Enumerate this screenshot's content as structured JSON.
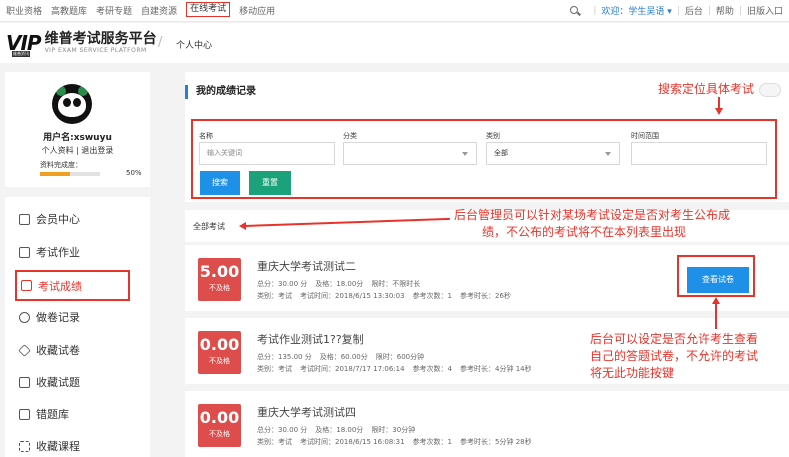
{
  "topnav": {
    "links": [
      "职业资格",
      "高教题库",
      "考研专题",
      "自建资源",
      "在线考试",
      "移动应用"
    ],
    "active_index": 4,
    "welcome": "欢迎：学生吴语 ▾",
    "right_links": [
      "后台",
      "帮助",
      "旧版入口"
    ]
  },
  "header": {
    "logo_mark": "VIP",
    "brand_sub": "维普资讯",
    "title_cn": "维普考试服务平台",
    "title_en": "VIP EXAM SERVICE PLATFORM",
    "breadcrumb": "个人中心"
  },
  "profile": {
    "username": "用户名:xswuyu",
    "links": "个人资料 | 退出登录",
    "completion_label": "资料完成度：",
    "completion_pct": "50%",
    "completion_value": 0.5
  },
  "menu": {
    "items": [
      "会员中心",
      "考试作业",
      "考试成绩",
      "做卷记录",
      "收藏试卷",
      "收藏试题",
      "错题库",
      "收藏课程"
    ],
    "active_index": 2
  },
  "records": {
    "title": "我的成绩记录",
    "filters": {
      "name_label": "名称",
      "name_placeholder": "输入关键词",
      "category_label": "分类",
      "type_label": "类别",
      "type_value": "全部",
      "time_label": "时间范围"
    },
    "search_btn": "搜索",
    "reset_btn": "重置",
    "list_title": "全部考试"
  },
  "exams": [
    {
      "score": "5.00",
      "status": "不及格",
      "name": "重庆大学考试测试二",
      "total": "总分：30.00 分",
      "pass": "及格：18.00分",
      "limit": "限时：不限时长",
      "type": "类别：考试",
      "time": "考试时间：2018/6/15 13:30:03",
      "attempts": "参考次数：1",
      "duration": "参考时长：26秒"
    },
    {
      "score": "0.00",
      "status": "不及格",
      "name": "考试作业测试1??复制",
      "total": "总分：135.00 分",
      "pass": "及格：60.00分",
      "limit": "限时：600分钟",
      "type": "类别：考试",
      "time": "考试时间：2018/7/17 17:06:14",
      "attempts": "参考次数：4",
      "duration": "参考时长：4分钟 14秒"
    },
    {
      "score": "0.00",
      "status": "不及格",
      "name": "重庆大学考试测试四",
      "total": "总分：30.00 分",
      "pass": "及格：18.00分",
      "limit": "限时：30分钟",
      "type": "类别：考试",
      "time": "考试时间：2018/6/15 16:08:31",
      "attempts": "参考次数：1",
      "duration": "参考时长：5分钟 28秒"
    }
  ],
  "view_btn": "查看试卷",
  "annotations": {
    "search": "搜索定位具体考试",
    "admin_1": "后台管理员可以针对某场考试设定是否对考生公布成",
    "admin_2": "绩，不公布的考试将不在本列表里出现",
    "view_1": "后台可以设定是否允许考生查看",
    "view_2": "自己的答题试卷，不允许的考试",
    "view_3": "将无此功能按键"
  },
  "colors": {
    "accent_red": "#e8332a",
    "blue": "#1e90e8",
    "green": "#1ba27a",
    "score_red": "#dc4d4b"
  }
}
